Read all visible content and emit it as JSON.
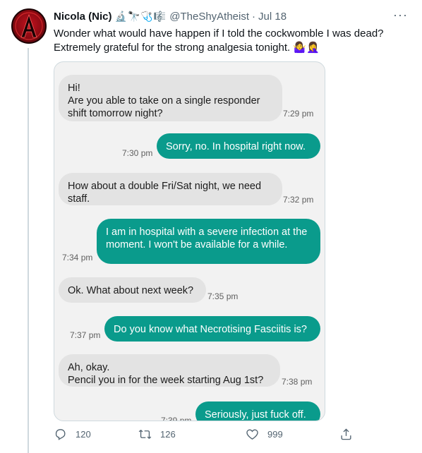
{
  "tweet": {
    "author_name": "Nicola (Nic)",
    "author_emojis": "🔬🔭🩺🎼",
    "handle": "@TheShyAtheist",
    "separator": "·",
    "date": "Jul 18",
    "more_label": "···",
    "text_line1": "Wonder what would have happen if I told the cockwomble I was dead?",
    "text_line2": "Extremely grateful for the strong analgesia tonight. 🤷‍♀️🤦‍♀️"
  },
  "messages": [
    {
      "dir": "in",
      "text": "Hi!\nAre you able to take on a single responder shift tomorrow night?",
      "time": "7:29 pm"
    },
    {
      "dir": "out",
      "text": "Sorry, no. In hospital right now.",
      "time": "7:30 pm"
    },
    {
      "dir": "in",
      "text": "How about a double Fri/Sat night, we need staff.",
      "time": "7:32 pm"
    },
    {
      "dir": "out",
      "text": "I am in hospital with a severe infection at the moment. I won't be available for a while.",
      "time": "7:34 pm"
    },
    {
      "dir": "in",
      "text": "Ok. What about next week?",
      "time": "7:35 pm"
    },
    {
      "dir": "out",
      "text": "Do you know what Necrotising Fasciitis is?",
      "time": "7:37 pm"
    },
    {
      "dir": "in",
      "text": "Ah, okay.\nPencil you in for the week starting Aug 1st?",
      "time": "7:38 pm"
    },
    {
      "dir": "out",
      "text": "Seriously, just fuck off.",
      "time": "7:39 pm"
    }
  ],
  "actions": {
    "replies": "120",
    "retweets": "126",
    "likes": "999",
    "share_label": ""
  },
  "colors": {
    "outgoing_bubble": "#0a9b8c",
    "incoming_bubble": "#e3e3e3",
    "secondary_text": "#536471"
  }
}
